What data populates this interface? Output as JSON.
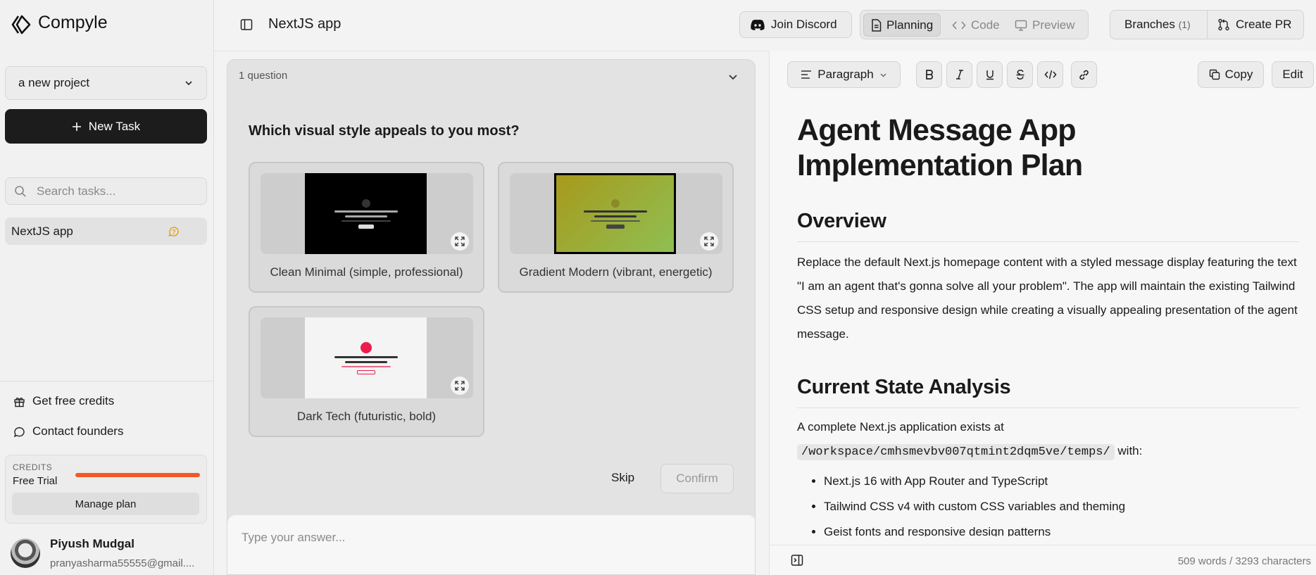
{
  "app": {
    "brand": "Compyle",
    "title": "NextJS app"
  },
  "sidebar": {
    "project_select": "a new project",
    "new_task_label": "New Task",
    "search_placeholder": "Search tasks...",
    "tasks": [
      {
        "label": "NextJS app",
        "status_icon": "question-badge-icon"
      }
    ],
    "links": [
      {
        "label": "Get free credits",
        "icon": "gift-icon"
      },
      {
        "label": "Contact founders",
        "icon": "chat-bubble-icon"
      }
    ],
    "credits": {
      "heading": "CREDITS",
      "plan": "Free Trial",
      "remaining_fraction": 1.0,
      "manage_label": "Manage plan"
    },
    "user": {
      "name": "Piyush Mudgal",
      "email": "pranyasharma55555@gmail...."
    }
  },
  "topbar": {
    "join_discord": "Join Discord",
    "modes": [
      {
        "label": "Planning",
        "icon": "document-icon",
        "active": true
      },
      {
        "label": "Code",
        "icon": "code-icon",
        "active": false
      },
      {
        "label": "Preview",
        "icon": "monitor-icon",
        "active": false
      }
    ],
    "branches_label": "Branches",
    "branches_count": "(1)",
    "create_pr": "Create PR"
  },
  "question_panel": {
    "count_label": "1 question",
    "question": "Which visual style appeals to you most?",
    "options": [
      {
        "label": "Clean Minimal (simple, professional)",
        "thumb_bg": "#000000",
        "accent": "#333333"
      },
      {
        "label": "Gradient Modern (vibrant, energetic)",
        "thumb_bg": "linear-gradient(135deg,#a79a1c,#8fbf52)",
        "accent": "#222222"
      },
      {
        "label": "Dark Tech (futuristic, bold)",
        "thumb_bg": "#f4f4f4",
        "accent": "#ee1c4e"
      }
    ],
    "skip_label": "Skip",
    "confirm_label": "Confirm",
    "answer_placeholder": "Type your answer..."
  },
  "editor": {
    "toolbar": {
      "block_type": "Paragraph",
      "copy_label": "Copy",
      "edit_label": "Edit"
    },
    "title": "Agent Message App Implementation Plan",
    "section1_heading": "Overview",
    "section1_text": "Replace the default Next.js homepage content with a styled message display featuring the text \"I am an agent that's gonna solve all your problem\". The app will maintain the existing Tailwind CSS setup and responsive design while creating a visually appealing presentation of the agent message.",
    "section2_heading": "Current State Analysis",
    "section2_intro": "A complete Next.js application exists at",
    "section2_path": "/workspace/cmhsmevbv007qtmint2dqm5ve/temps/",
    "section2_with": " with:",
    "bullets": [
      "Next.js 16 with App Router and TypeScript",
      "Tailwind CSS v4 with custom CSS variables and theming",
      "Geist fonts and responsive design patterns"
    ],
    "stats": "509 words / 3293 characters"
  }
}
